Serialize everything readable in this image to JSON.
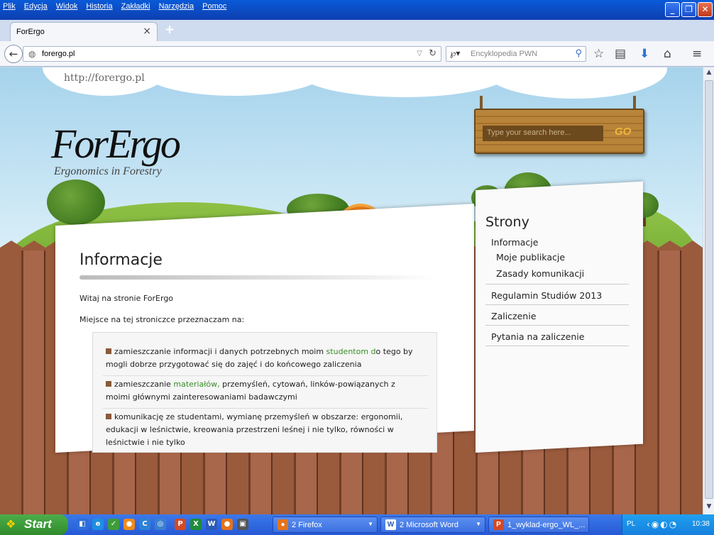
{
  "browser": {
    "menu": [
      "Plik",
      "Edycja",
      "Widok",
      "Historia",
      "Zakładki",
      "Narzędzia",
      "Pomoc"
    ],
    "tab_title": "ForErgo",
    "tab_close": "×",
    "new_tab": "+",
    "url": "forergo.pl",
    "search_placeholder": "Encyklopedia PWN"
  },
  "site": {
    "host_url": "http://forergo.pl",
    "logo": "ForErgo",
    "tagline": "Ergonomics in Forestry",
    "search_placeholder": "Type your search here...",
    "search_go": "GO"
  },
  "post": {
    "title": "Informacje",
    "p1": "Witaj na stronie ForErgo",
    "p2": "Miejsce na tej stroniczce przeznaczam na:",
    "items": [
      {
        "pre": "zamieszczanie informacji i danych potrzebnych moim ",
        "link": "studentom d",
        "post": "o tego by",
        "line2": "mogli dobrze przygotować się do zajęć i do końcowego zaliczenia"
      },
      {
        "pre": "zamieszczanie ",
        "link": "materiałów,",
        "post": " przemyśleń, cytowań, linków-powiązanych z",
        "line2": "moimi głównymi zainteresowaniami badawczymi"
      },
      {
        "pre": "komunikację ze studentami, wymianę przemyśleń w obszarze: ergonomii,",
        "link": "",
        "post": "",
        "line2": "edukacji  w leśnictwie, kreowania przestrzeni leśnej i nie tylko, równości w",
        "line3": "leśnictwie i nie tylko"
      }
    ]
  },
  "sidebar": {
    "title": "Strony",
    "items": [
      "Informacje",
      "Moje publikacje",
      "Zasady komunikacji",
      "Regulamin Studiów 2013",
      "Zaliczenie",
      "Pytania na zaliczenie"
    ]
  },
  "taskbar": {
    "start": "Start",
    "tasks": [
      "2 Firefox",
      "2 Microsoft Word",
      "1_wyklad-ergo_WL_..."
    ],
    "lang": "PL",
    "clock": "10:38"
  }
}
